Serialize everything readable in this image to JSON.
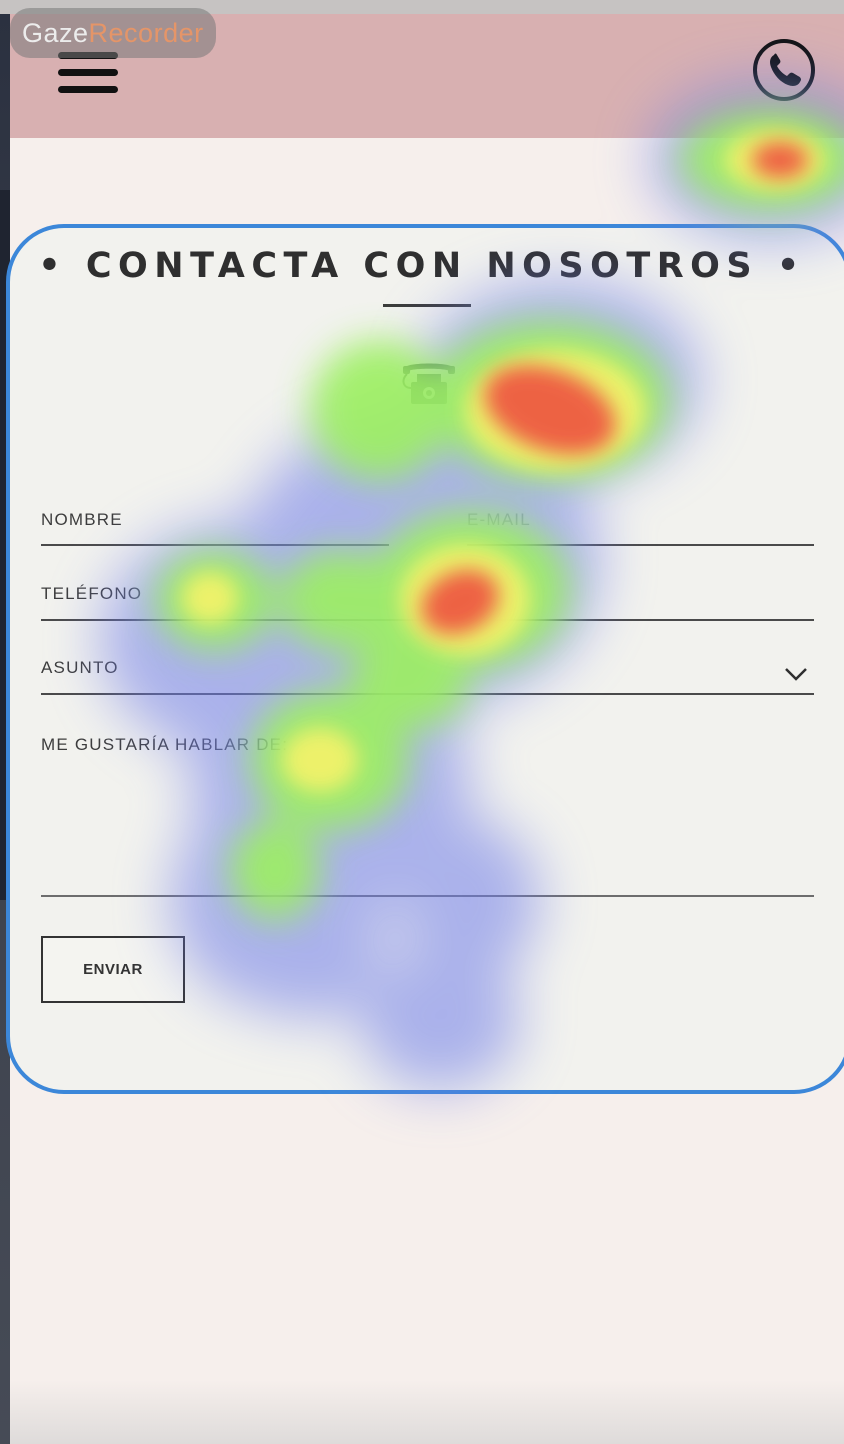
{
  "watermark": {
    "part1": "Gaze",
    "part2": "Recorder"
  },
  "header": {
    "menu_icon": "hamburger-menu-icon",
    "phone_icon": "phone-icon",
    "background": "#d8b0b1"
  },
  "contact": {
    "title": "• CONTACTA CON NOSOTROS •",
    "illustration_icon": "vintage-telephone-icon",
    "fields": {
      "nombre": "NOMBRE",
      "email": "E-MAIL",
      "telefono": "TELÉFONO",
      "asunto": "ASUNTO",
      "mensaje": "ME GUSTARÍA HABLAR DE:"
    },
    "select_icon": "chevron-down-icon",
    "submit_label": "ENVIAR"
  },
  "colors": {
    "card_border": "#3c87d9",
    "page_background": "#f6efec",
    "card_background": "#f2f2ee"
  }
}
